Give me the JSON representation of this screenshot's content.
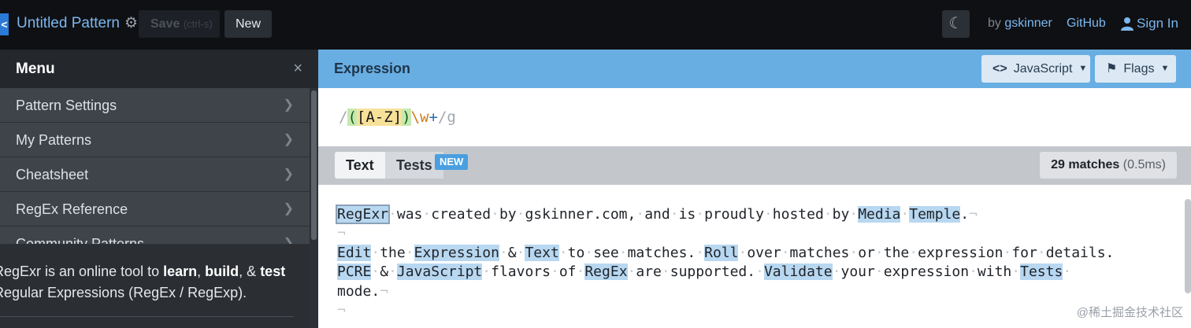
{
  "app": {
    "title": "Untitled Pattern",
    "save_label": "Save",
    "save_hint": "(ctrl-s)",
    "new_label": "New",
    "by_prefix": "by",
    "author": "gskinner",
    "github_label": "GitHub",
    "signin_label": "Sign In"
  },
  "sidebar": {
    "menu_title": "Menu",
    "close_glyph": "×",
    "items": [
      {
        "label": "Pattern Settings"
      },
      {
        "label": "My Patterns"
      },
      {
        "label": "Cheatsheet"
      },
      {
        "label": "RegEx Reference"
      },
      {
        "label": "Community Patterns"
      }
    ],
    "blurb": {
      "line1_prefix": "RegExr is an online tool to ",
      "learn": "learn",
      "sep1": ", ",
      "build": "build",
      "sep2": ", & ",
      "test": "test",
      "line2": "Regular Expressions (RegEx / RegExp)."
    }
  },
  "expression": {
    "header": "Expression",
    "flavor_label": "JavaScript",
    "flags_label": "Flags",
    "open_slash": "/",
    "group_open": "(",
    "class_open": "[",
    "range": "A-Z",
    "class_close": "]",
    "group_close": ")",
    "escape": "\\w",
    "quantifier": "+",
    "close_slash": "/",
    "flags": "g"
  },
  "text_panel": {
    "tab_text": "Text",
    "tab_tests": "Tests",
    "new_badge": "NEW",
    "matches_count": "29 matches",
    "matches_time": "(0.5ms)",
    "lines": {
      "l1": {
        "w1": "RegExr",
        "w2": "was",
        "w3": "created",
        "w4": "by",
        "w5": "gskinner.com,",
        "w6": "and",
        "w7": "is",
        "w8": "proudly",
        "w9": "hosted",
        "w10": "by",
        "w11": "Media",
        "w12": "Temple",
        "w13": "."
      },
      "l3": {
        "w1": "Edit",
        "w2": "the",
        "w3": "Expression",
        "w4": "&",
        "w5": "Text",
        "w6": "to",
        "w7": "see",
        "w8": "matches.",
        "w9": "Roll",
        "w10": "over",
        "w11": "matches",
        "w12": "or",
        "w13": "the",
        "w14": "expression",
        "w15": "for",
        "w16": "details."
      },
      "l4": {
        "w1": "PCRE",
        "w2": "&",
        "w3": "JavaScript",
        "w4": "flavors",
        "w5": "of",
        "w6": "RegEx",
        "w7": "are",
        "w8": "supported.",
        "w9": "Validate",
        "w10": "your",
        "w11": "expression",
        "w12": "with",
        "w13": "Tests"
      },
      "l5": {
        "w1": "mode."
      }
    }
  },
  "watermark": "@稀土掘金技术社区"
}
